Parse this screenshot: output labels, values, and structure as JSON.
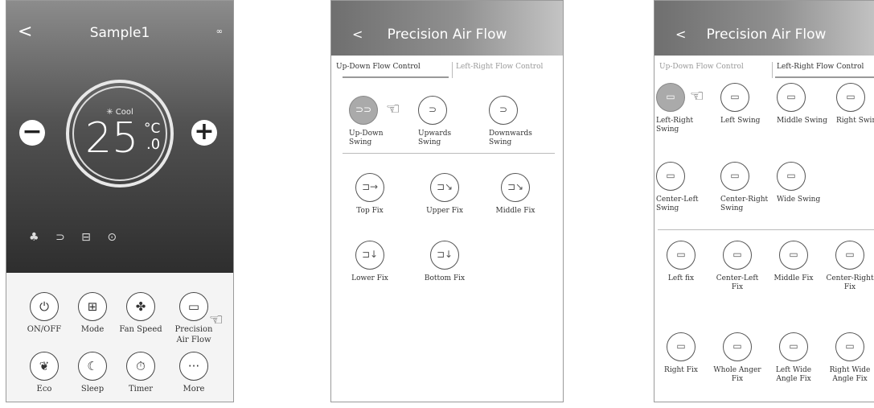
{
  "screen1": {
    "title": "Sample1",
    "back": "<",
    "more_dots": "∞",
    "mode": "✳ Cool",
    "temp": "25",
    "unit": "°C",
    "decimal": ".0",
    "minus": "−",
    "plus": "+",
    "status_icons": "♣ ⊃ ⊟ ⊙",
    "buttons": [
      {
        "label": "ON/OFF",
        "icon": "power-icon",
        "glyph": "⏻"
      },
      {
        "label": "Mode",
        "icon": "mode-icon",
        "glyph": "⊞"
      },
      {
        "label": "Fan Speed",
        "icon": "fan-icon",
        "glyph": "✤"
      },
      {
        "label": "Precision Air Flow",
        "icon": "airflow-icon",
        "glyph": "▭"
      },
      {
        "label": "Eco",
        "icon": "eco-icon",
        "glyph": "❦"
      },
      {
        "label": "Sleep",
        "icon": "sleep-icon",
        "glyph": "☾"
      },
      {
        "label": "Timer",
        "icon": "timer-icon",
        "glyph": "⏱"
      },
      {
        "label": "More",
        "icon": "more-icon",
        "glyph": "···"
      }
    ]
  },
  "screen2": {
    "title": "Precision Air Flow",
    "back": "<",
    "tab_active": "Up-Down Flow Control",
    "tab_inactive": "Left-Right Flow Control",
    "items": [
      {
        "label": "Up-Down Swing",
        "glyph": "⊃⊃"
      },
      {
        "label": "Upwards Swing",
        "glyph": "⊃"
      },
      {
        "label": "Downwards Swing",
        "glyph": "⊃"
      },
      {
        "label": "Top Fix",
        "glyph": "⊐→"
      },
      {
        "label": "Upper Fix",
        "glyph": "⊐↘"
      },
      {
        "label": "Middle Fix",
        "glyph": "⊐↘"
      },
      {
        "label": "Lower Fix",
        "glyph": "⊐↓"
      },
      {
        "label": "Bottom Fix",
        "glyph": "⊐↓"
      }
    ]
  },
  "screen3": {
    "title": "Precision Air Flow",
    "back": "<",
    "tab_inactive": "Up-Down Flow Control",
    "tab_active": "Left-Right Flow Control",
    "items": [
      {
        "label": "Left-Right Swing",
        "glyph": "▭"
      },
      {
        "label": "Left Swing",
        "glyph": "▭"
      },
      {
        "label": "Middle Swing",
        "glyph": "▭"
      },
      {
        "label": "Right Swing",
        "glyph": "▭"
      },
      {
        "label": "Center-Left Swing",
        "glyph": "▭"
      },
      {
        "label": "Center-Right Swing",
        "glyph": "▭"
      },
      {
        "label": "Wide Swing",
        "glyph": "▭"
      },
      {
        "label": "Left fix",
        "glyph": "▭"
      },
      {
        "label": "Center-Left Fix",
        "glyph": "▭"
      },
      {
        "label": "Middle Fix",
        "glyph": "▭"
      },
      {
        "label": "Center-Right Fix",
        "glyph": "▭"
      },
      {
        "label": "Right Fix",
        "glyph": "▭"
      },
      {
        "label": "Whole Anger Fix",
        "glyph": "▭"
      },
      {
        "label": "Left Wide Angle Fix",
        "glyph": "▭"
      },
      {
        "label": "Right Wide Angle Fix",
        "glyph": "▭"
      }
    ]
  }
}
